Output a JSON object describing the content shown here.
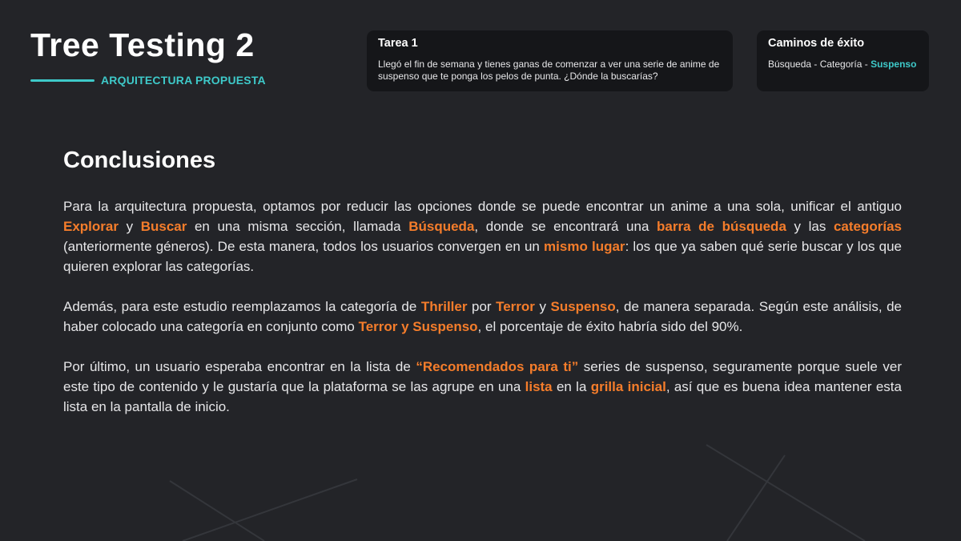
{
  "header": {
    "title": "Tree Testing 2",
    "subtitle": "ARQUITECTURA PROPUESTA"
  },
  "task_card": {
    "title": "Tarea 1",
    "text": "Llegó el fin de semana y tienes ganas de comenzar a ver una serie de anime de suspenso que te ponga los pelos de punta. ¿Dónde la buscarías?"
  },
  "paths_card": {
    "title": "Caminos de éxito",
    "path_prefix": "Búsqueda - Categoría - ",
    "path_final": "Suspenso"
  },
  "content": {
    "heading": "Conclusiones",
    "p1": [
      {
        "t": "Para la arquitectura propuesta, optamos por reducir las opciones donde se puede encontrar un anime a una sola, unificar el antiguo ",
        "hl": false
      },
      {
        "t": "Explorar",
        "hl": true
      },
      {
        "t": " y ",
        "hl": false
      },
      {
        "t": "Buscar",
        "hl": true
      },
      {
        "t": " en una misma sección, llamada ",
        "hl": false
      },
      {
        "t": "Búsqueda",
        "hl": true
      },
      {
        "t": ", donde se encontrará una ",
        "hl": false
      },
      {
        "t": "barra de búsqueda",
        "hl": true
      },
      {
        "t": " y las ",
        "hl": false
      },
      {
        "t": "categorías",
        "hl": true
      },
      {
        "t": " (anteriormente géneros). De esta manera, todos los usuarios convergen en un ",
        "hl": false
      },
      {
        "t": "mismo lugar",
        "hl": true
      },
      {
        "t": ": los que ya saben qué serie buscar y los que quieren explorar las categorías.",
        "hl": false
      }
    ],
    "p2": [
      {
        "t": "Además, para este estudio reemplazamos la categoría de ",
        "hl": false
      },
      {
        "t": "Thriller",
        "hl": true
      },
      {
        "t": " por ",
        "hl": false
      },
      {
        "t": "Terror",
        "hl": true
      },
      {
        "t": " y ",
        "hl": false
      },
      {
        "t": "Suspenso",
        "hl": true
      },
      {
        "t": ", de manera separada. Según este análisis, de haber colocado una categoría en conjunto como ",
        "hl": false
      },
      {
        "t": "Terror y Suspenso",
        "hl": true
      },
      {
        "t": ", el porcentaje de éxito habría sido del 90%.",
        "hl": false
      }
    ],
    "p3": [
      {
        "t": "Por último, un usuario esperaba encontrar en la lista de ",
        "hl": false
      },
      {
        "t": "“Recomendados para ti”",
        "hl": true
      },
      {
        "t": " series de suspenso, seguramente porque suele ver este tipo de contenido y le gustaría que la plataforma se las agrupe en una ",
        "hl": false
      },
      {
        "t": "lista",
        "hl": true
      },
      {
        "t": " en la ",
        "hl": false
      },
      {
        "t": "grilla inicial",
        "hl": true
      },
      {
        "t": ", así que es buena idea mantener esta lista en la pantalla de inicio.",
        "hl": false
      }
    ]
  },
  "colors": {
    "background": "#232428",
    "card_background": "#151619",
    "accent_teal": "#3ec9c9",
    "highlight_orange": "#f57d2b",
    "body_text": "#e6e6e8"
  }
}
